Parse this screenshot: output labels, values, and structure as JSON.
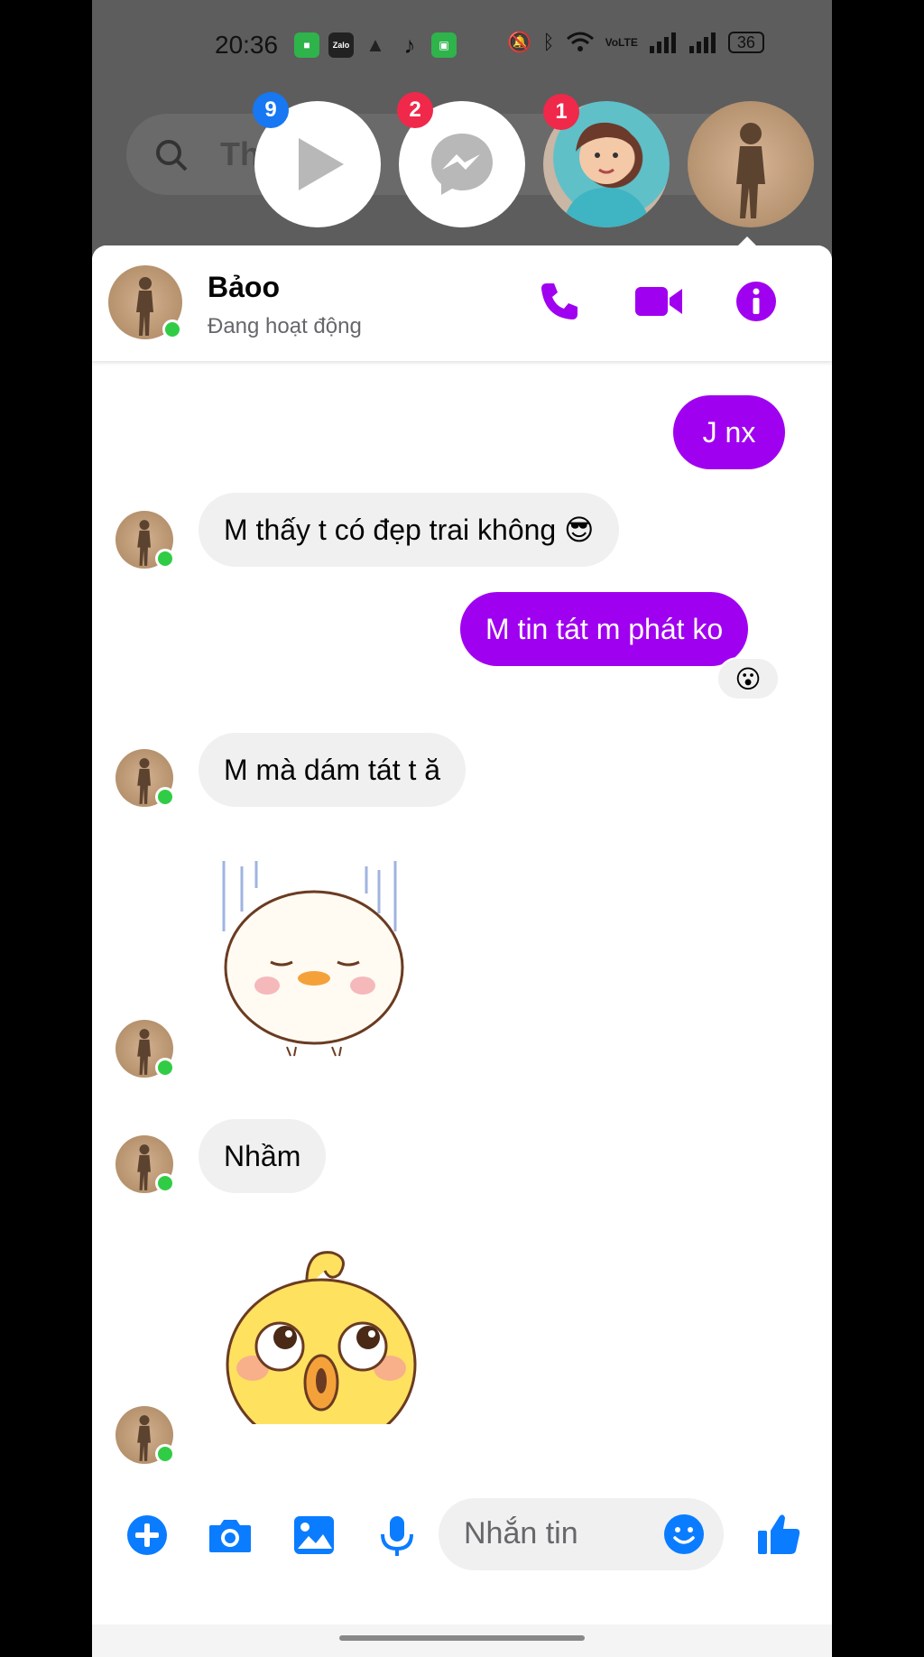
{
  "status_bar": {
    "time": "20:36",
    "battery": "36",
    "network_label": "VoLTE",
    "apps": [
      "Zalo"
    ]
  },
  "search": {
    "placeholder_partial": "Th"
  },
  "chat_heads": [
    {
      "type": "video-player",
      "badge": "9",
      "badge_color": "#1877f2"
    },
    {
      "type": "messenger",
      "badge": "2",
      "badge_color": "#f0284a"
    },
    {
      "type": "contact-photo",
      "badge": "1",
      "badge_color": "#f0284a"
    },
    {
      "type": "contact-photo-active",
      "badge": ""
    }
  ],
  "conversation": {
    "contact_name": "Bảoo",
    "contact_status": "Đang hoạt động",
    "accent_color": "#a000f0",
    "icons": [
      "phone-icon",
      "video-call-icon",
      "info-icon"
    ]
  },
  "messages": [
    {
      "side": "out",
      "text": "J nx"
    },
    {
      "side": "in",
      "text": "M thấy t có đẹp trai không 😎"
    },
    {
      "side": "out",
      "text": "M tin tát m phát ko",
      "reaction": "😮"
    },
    {
      "side": "in",
      "text": "M mà dám tát t ă"
    },
    {
      "side": "in",
      "sticker": "sad-chick"
    },
    {
      "side": "in",
      "text": "Nhầm"
    },
    {
      "side": "in",
      "sticker": "confused-chick"
    }
  ],
  "composer": {
    "placeholder": "Nhắn tin",
    "icons": [
      "plus-icon",
      "camera-icon",
      "gallery-icon",
      "microphone-icon",
      "emoji-icon",
      "like-icon"
    ]
  }
}
